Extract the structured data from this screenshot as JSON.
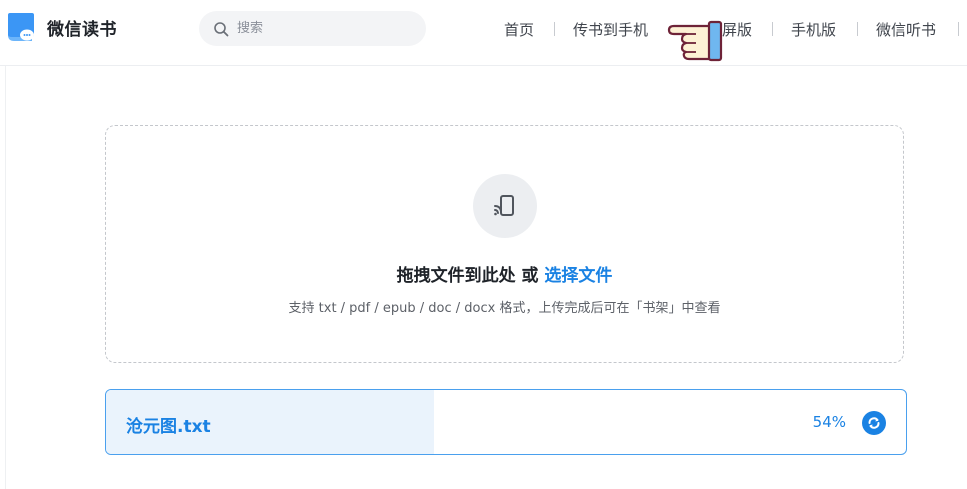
{
  "header": {
    "app_name": "微信读书",
    "search": {
      "placeholder": "搜索",
      "value": ""
    },
    "nav": [
      {
        "label": "首页"
      },
      {
        "label": "传书到手机"
      },
      {
        "label": "屏版"
      },
      {
        "label": "手机版"
      },
      {
        "label": "微信听书"
      }
    ]
  },
  "upload": {
    "title_prefix": "拖拽文件到此处 或 ",
    "title_link": "选择文件",
    "hint": "支持 txt / pdf / epub / doc / docx 格式，上传完成后可在「书架」中查看"
  },
  "file": {
    "name": "沧元图.txt",
    "percent_label": "54%",
    "progress": 0.41
  },
  "colors": {
    "accent": "#1a82e3",
    "progress_bg": "#eaf3fc",
    "logo_blue": "#3b96f5"
  },
  "icons": [
    "logo-book-icon",
    "search-icon",
    "pointing-hand-cursor-icon",
    "cast-to-phone-icon",
    "refresh-icon"
  ]
}
